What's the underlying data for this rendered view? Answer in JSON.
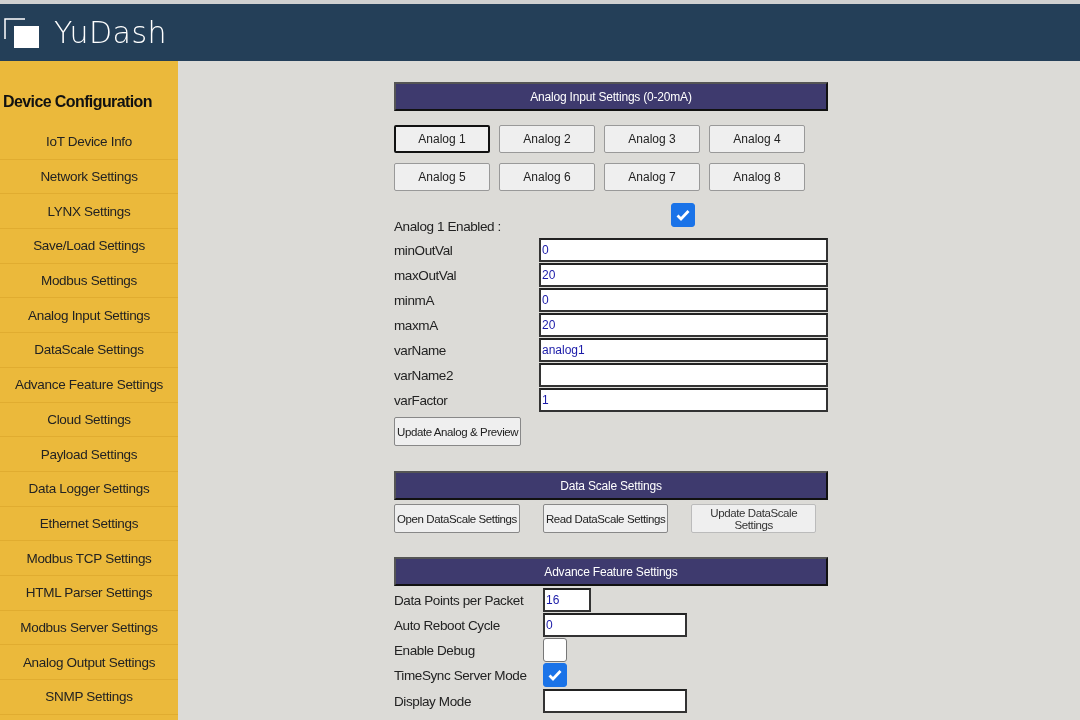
{
  "header": {
    "brand": "YuDash"
  },
  "sidebar": {
    "title": "Device Configuration",
    "items": [
      {
        "label": "IoT Device Info"
      },
      {
        "label": "Network Settings"
      },
      {
        "label": "LYNX Settings"
      },
      {
        "label": "Save/Load Settings"
      },
      {
        "label": "Modbus Settings"
      },
      {
        "label": "Analog Input Settings"
      },
      {
        "label": "DataScale Settings"
      },
      {
        "label": "Advance Feature Settings"
      },
      {
        "label": "Cloud Settings"
      },
      {
        "label": "Payload Settings"
      },
      {
        "label": "Data Logger Settings"
      },
      {
        "label": "Ethernet Settings"
      },
      {
        "label": "Modbus TCP Settings"
      },
      {
        "label": "HTML Parser Settings"
      },
      {
        "label": "Modbus Server Settings"
      },
      {
        "label": "Analog Output Settings"
      },
      {
        "label": "SNMP Settings"
      }
    ]
  },
  "analog_section": {
    "title": "Analog Input Settings (0-20mA)",
    "channels": [
      {
        "label": "Analog 1",
        "selected": true
      },
      {
        "label": "Analog 2",
        "selected": false
      },
      {
        "label": "Analog 3",
        "selected": false
      },
      {
        "label": "Analog 4",
        "selected": false
      },
      {
        "label": "Analog 5",
        "selected": false
      },
      {
        "label": "Analog 6",
        "selected": false
      },
      {
        "label": "Analog 7",
        "selected": false
      },
      {
        "label": "Analog 8",
        "selected": false
      }
    ],
    "enabled": {
      "label": "Analog 1 Enabled :",
      "checked": true
    },
    "fields": [
      {
        "label": "minOutVal",
        "value": "0"
      },
      {
        "label": "maxOutVal",
        "value": "20"
      },
      {
        "label": "minmA",
        "value": "0"
      },
      {
        "label": "maxmA",
        "value": "20"
      },
      {
        "label": "varName",
        "value": "analog1"
      },
      {
        "label": "varName2"
      },
      {
        "label": "varFactor",
        "value": "1"
      }
    ],
    "button": "Update Analog & Preview"
  },
  "datascale_section": {
    "title": "Data Scale Settings",
    "buttons": [
      {
        "label": "Open DataScale Settings",
        "disabled": false
      },
      {
        "label": "Read DataScale Settings",
        "disabled": false
      },
      {
        "label": "Update DataScale Settings",
        "disabled": true
      }
    ]
  },
  "advance_section": {
    "title": "Advance Feature Settings",
    "fields": [
      {
        "kind": "number",
        "label": "Data Points per Packet",
        "value": "16"
      },
      {
        "kind": "text",
        "label": "Auto Reboot Cycle",
        "value": "0"
      },
      {
        "kind": "checkbox",
        "label": "Enable Debug",
        "checked": false
      },
      {
        "kind": "checkbox",
        "label": "TimeSync Server Mode",
        "checked": true
      },
      {
        "kind": "text",
        "label": "Display Mode"
      }
    ]
  }
}
